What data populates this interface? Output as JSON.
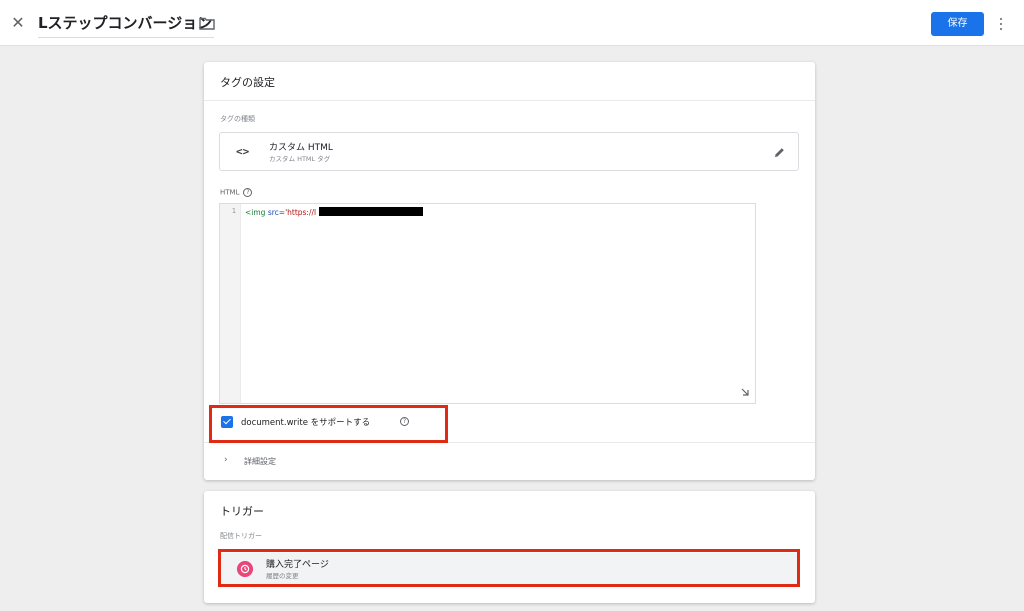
{
  "header": {
    "close_icon": "close-icon",
    "title": "Lステップコンバージョン",
    "folder_icon": "folder-icon",
    "save_label": "保存",
    "more_icon": "more-vert-icon",
    "save_color": "#1a73e8"
  },
  "tag_config": {
    "title": "タグの設定",
    "tag_type_label": "タグの種類",
    "tag_type": {
      "icon": "code-icon",
      "name": "カスタム HTML",
      "subtitle": "カスタム HTML タグ",
      "edit_icon": "pencil-icon"
    },
    "html_label": "HTML",
    "help_glyph": "?",
    "editor": {
      "line_number": "1",
      "code_tag": "<img",
      "code_attr": " src=",
      "code_string": "'https://l"
    },
    "support_document_write": {
      "label": "document.write をサポートする",
      "checked": true
    },
    "advanced_label": "詳細設定"
  },
  "trigger": {
    "title": "トリガー",
    "firing_label": "配信トリガー",
    "items": [
      {
        "name": "購入完了ページ",
        "type": "履歴の変更",
        "icon": "history-change-icon",
        "icon_color": "#e8477a"
      }
    ]
  },
  "highlight_color": "#e02a14"
}
